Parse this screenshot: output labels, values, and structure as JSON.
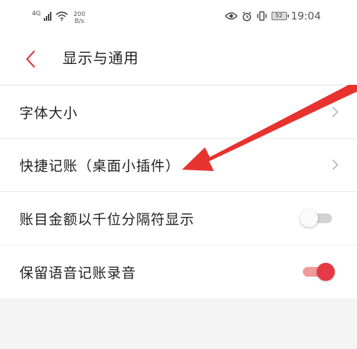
{
  "status_bar": {
    "network_type": "4G",
    "speed_value": "200",
    "speed_unit": "B/s",
    "battery_level": "52",
    "time": "19:04"
  },
  "nav": {
    "title": "显示与通用"
  },
  "settings": {
    "items": [
      {
        "label": "字体大小",
        "control": "chevron"
      },
      {
        "label": "快捷记账（桌面小插件）",
        "control": "chevron"
      },
      {
        "label": "账目金额以千位分隔符显示",
        "control": "toggle",
        "checked": false
      },
      {
        "label": "保留语音记账录音",
        "control": "toggle",
        "checked": true
      }
    ]
  },
  "colors": {
    "accent": "#e63946",
    "annotation_arrow": "#e8322f"
  }
}
